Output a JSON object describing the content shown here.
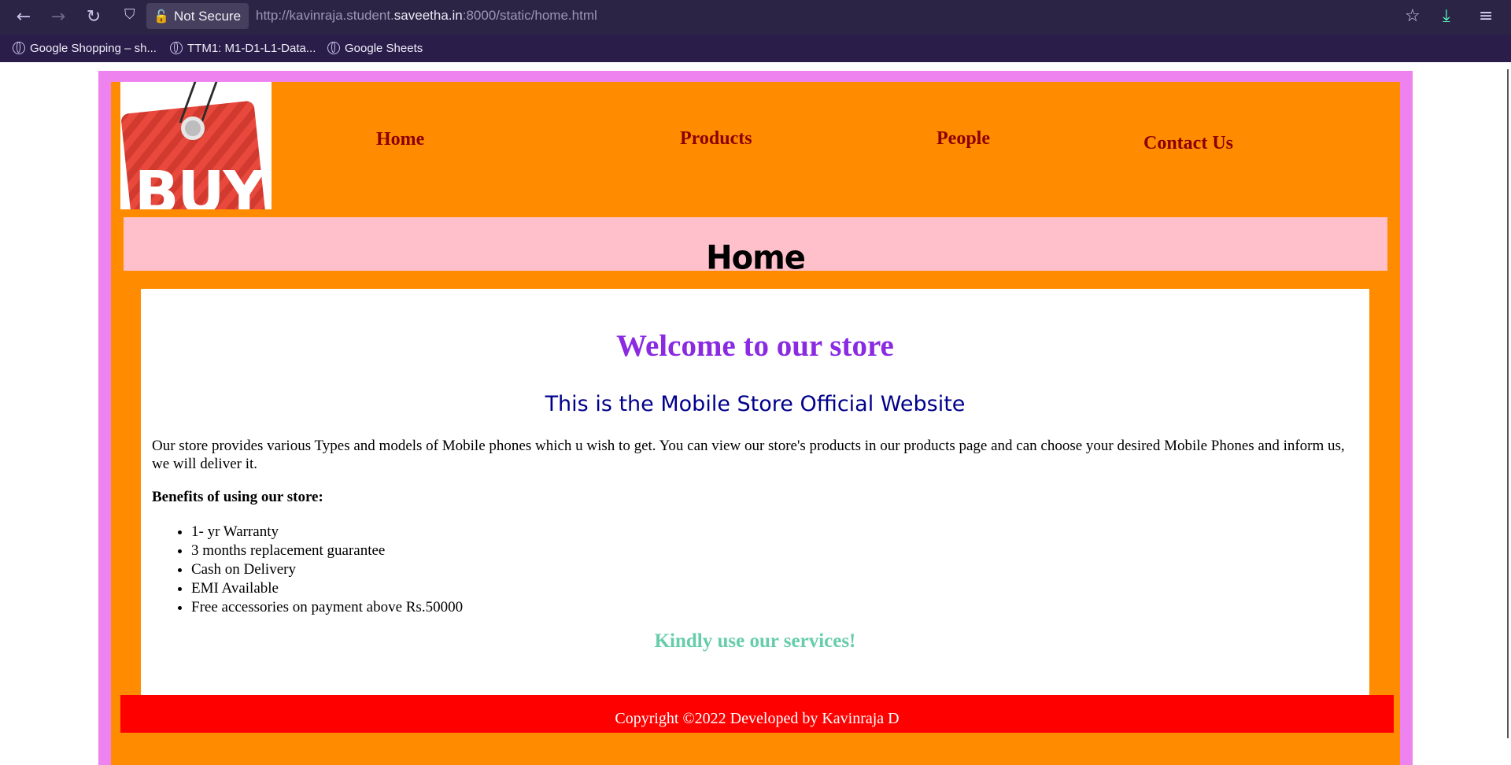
{
  "browser": {
    "security_label": "Not Secure",
    "url_prefix": "http://kavinraja.student.",
    "url_domain": "saveetha.in",
    "url_suffix": ":8000/static/home.html",
    "bookmarks": [
      {
        "label": "Google Shopping – sh..."
      },
      {
        "label": "TTM1: M1-D1-L1-Data..."
      },
      {
        "label": "Google Sheets"
      }
    ]
  },
  "logo": {
    "text": "BUY"
  },
  "nav": {
    "home": "Home",
    "products": "Products",
    "people": "People",
    "contact": "Contact Us"
  },
  "page": {
    "heading": "Home"
  },
  "main": {
    "welcome": "Welcome to our store",
    "subtitle": "This is the Mobile Store Official Website",
    "description": "Our store provides various Types and models of Mobile phones which u wish to get. You can view our store's products in our products page and can choose your desired Mobile Phones and inform us, we will deliver it.",
    "benefits_title": "Benefits of using our store:",
    "benefits": [
      "1- yr Warranty",
      "3 months replacement guarantee",
      "Cash on Delivery",
      "EMI Available",
      "Free accessories on payment above Rs.50000"
    ],
    "closing": "Kindly use our services!"
  },
  "footer": {
    "text": "Copyright ©2022 Developed by Kavinraja D"
  },
  "colors": {
    "outer_border": "#ee82ee",
    "background": "#ff8c00",
    "nav_link": "#8b0000",
    "heading_band": "#ffc0cb",
    "welcome": "#8a2be2",
    "subtitle": "#00008b",
    "closing": "#66cdaa",
    "footer": "#ff0000"
  }
}
